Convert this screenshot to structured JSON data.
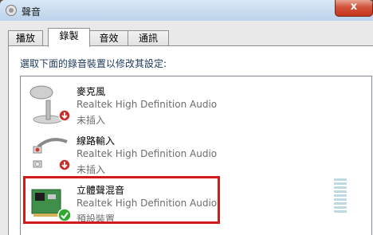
{
  "window": {
    "title": "聲音",
    "close_glyph": "x"
  },
  "tabs": [
    {
      "label": "播放",
      "active": false
    },
    {
      "label": "錄製",
      "active": true
    },
    {
      "label": "音效",
      "active": false
    },
    {
      "label": "通訊",
      "active": false
    }
  ],
  "instruction": "選取下面的錄音裝置以修改其設定:",
  "devices": [
    {
      "name": "麥克風",
      "driver": "Realtek High Definition Audio",
      "status": "未插入",
      "icon": "microphone-icon",
      "badge": "unplugged-badge-icon",
      "selected": false
    },
    {
      "name": "線路輸入",
      "driver": "Realtek High Definition Audio",
      "status": "未插入",
      "icon": "line-in-cable-icon",
      "badge": "unplugged-badge-icon",
      "selected": false
    },
    {
      "name": "立體聲混音",
      "driver": "Realtek High Definition Audio",
      "status": "預設裝置",
      "icon": "sound-card-icon",
      "badge": "default-check-icon",
      "selected": true
    }
  ],
  "colors": {
    "highlight_border": "#d21a1a",
    "default_badge": "#2fa82f",
    "unplugged_badge": "#c9302c"
  }
}
